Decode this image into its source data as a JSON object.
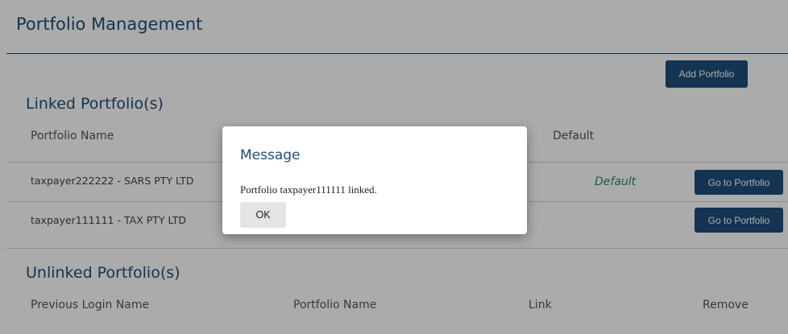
{
  "header": {
    "title": "Portfolio Management"
  },
  "toolbar": {
    "add_label": "Add Portfolio"
  },
  "linked": {
    "title": "Linked Portfolio(s)",
    "columns": [
      "Portfolio Name",
      "Default"
    ],
    "rows": [
      {
        "name": "taxpayer222222 - SARS PTY LTD",
        "default": "Default",
        "action": "Go to Portfolio"
      },
      {
        "name": "taxpayer111111 - TAX PTY LTD",
        "default": "",
        "action": "Go to Portfolio"
      }
    ]
  },
  "unlinked": {
    "title": "Unlinked Portfolio(s)",
    "columns": [
      "Previous Login Name",
      "Portfolio Name",
      "Link",
      "Remove"
    ]
  },
  "modal": {
    "title": "Message",
    "message": "Portfolio taxpayer111111 linked.",
    "ok_label": "OK"
  },
  "colors": {
    "brand": "#1f4e79",
    "default_text": "#2e8b57",
    "overlay": "rgba(0,0,0,0.33)"
  }
}
